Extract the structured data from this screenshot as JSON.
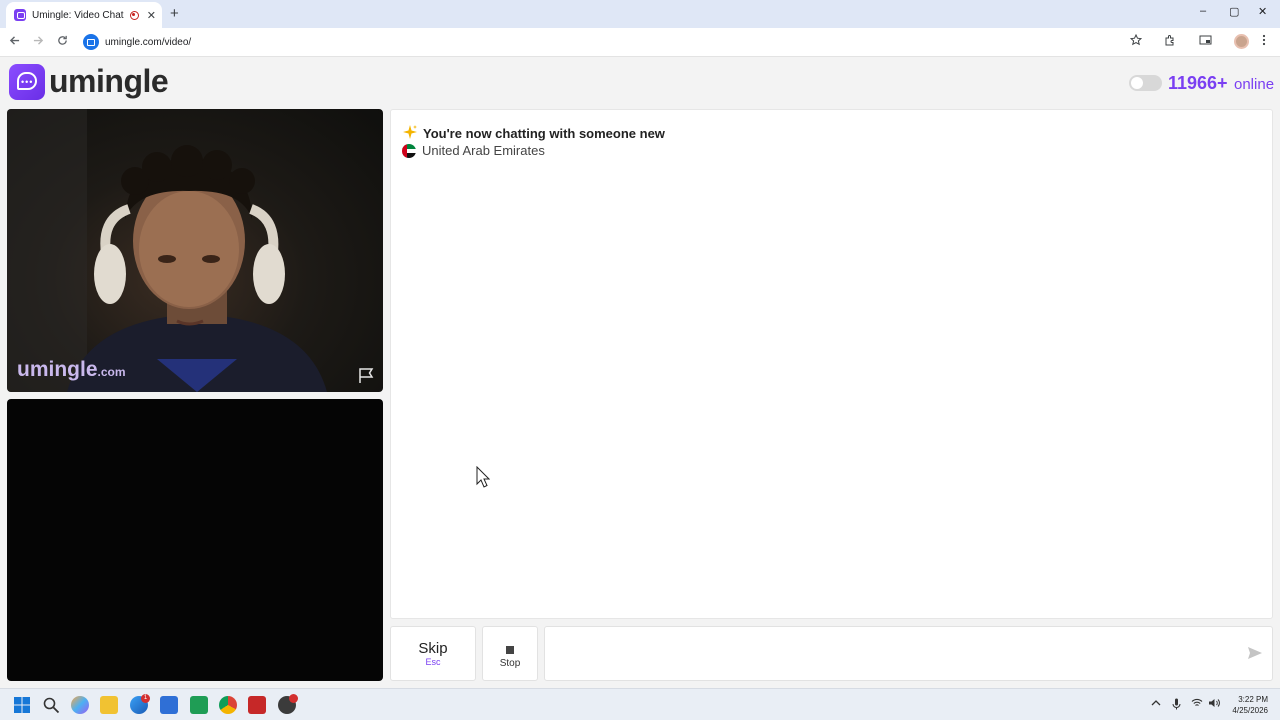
{
  "browser": {
    "tab_title": "Umingle: Video Chat with S",
    "tab_close": "✕",
    "new_tab": "+",
    "window_controls": {
      "minimize": "–",
      "maximize": "▢",
      "close": "✕"
    },
    "url": "umingle.com/video/",
    "icons": [
      "back-arrow-icon",
      "forward-arrow-icon",
      "reload-icon",
      "star-icon",
      "extensions-icon",
      "cast-icon",
      "profile-avatar",
      "menu-dots-icon"
    ]
  },
  "header": {
    "logo_text": "umingle",
    "online_count": "11966+",
    "online_label": "online",
    "theme_toggle_on": false
  },
  "video": {
    "watermark_main": "umingle",
    "watermark_suffix": ".com"
  },
  "chat": {
    "status_message": "You're now chatting with someone new",
    "status_icon": "sparkle-icon",
    "country": "United Arab Emirates",
    "country_flag": "uae-flag-icon"
  },
  "controls": {
    "skip_label": "Skip",
    "skip_shortcut": "Esc",
    "stop_label": "Stop",
    "message_placeholder": ""
  },
  "taskbar": {
    "time": "3:22 PM",
    "date": "4/25/2026",
    "notification_badge": "1"
  },
  "colors": {
    "brand_purple": "#7a3ff2",
    "page_background": "#f3f3f3"
  }
}
